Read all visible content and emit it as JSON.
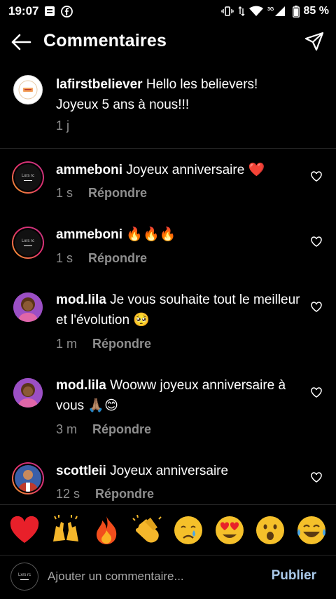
{
  "status_bar": {
    "time": "19:07",
    "battery": "85 %",
    "network": "3G"
  },
  "header": {
    "title": "Commentaires"
  },
  "caption": {
    "username": "lafirstbeliever",
    "text": " Hello les believers! Joyeux 5 ans à nous!!!",
    "time": "1 j"
  },
  "comments": [
    {
      "username": "ammeboni",
      "text": " Joyeux anniversaire ",
      "emoji": "❤️",
      "time": "1 s",
      "reply": "Répondre"
    },
    {
      "username": "ammeboni",
      "text": " ",
      "emoji": "🔥🔥🔥",
      "time": "1 s",
      "reply": "Répondre"
    },
    {
      "username": "mod.lila",
      "text": " Je vous souhaite tout le meilleur et l'évolution ",
      "emoji": "🥺",
      "time": "1 m",
      "reply": "Répondre"
    },
    {
      "username": "mod.lila",
      "text": " Wooww joyeux anniversaire à vous ",
      "emoji": "🙏🏽😊",
      "time": "3 m",
      "reply": "Répondre"
    },
    {
      "username": "scottleii",
      "text": " Joyeux anniversaire",
      "emoji": "",
      "time": "12 s",
      "reply": "Répondre"
    }
  ],
  "emoji_bar": [
    "❤️",
    "🙌",
    "🔥",
    "👏",
    "😢",
    "😍",
    "😮",
    "😂"
  ],
  "input": {
    "placeholder": "Ajouter un commentaire...",
    "publish_label": "Publier"
  },
  "avatar_logo_text": "Lxrs rc"
}
